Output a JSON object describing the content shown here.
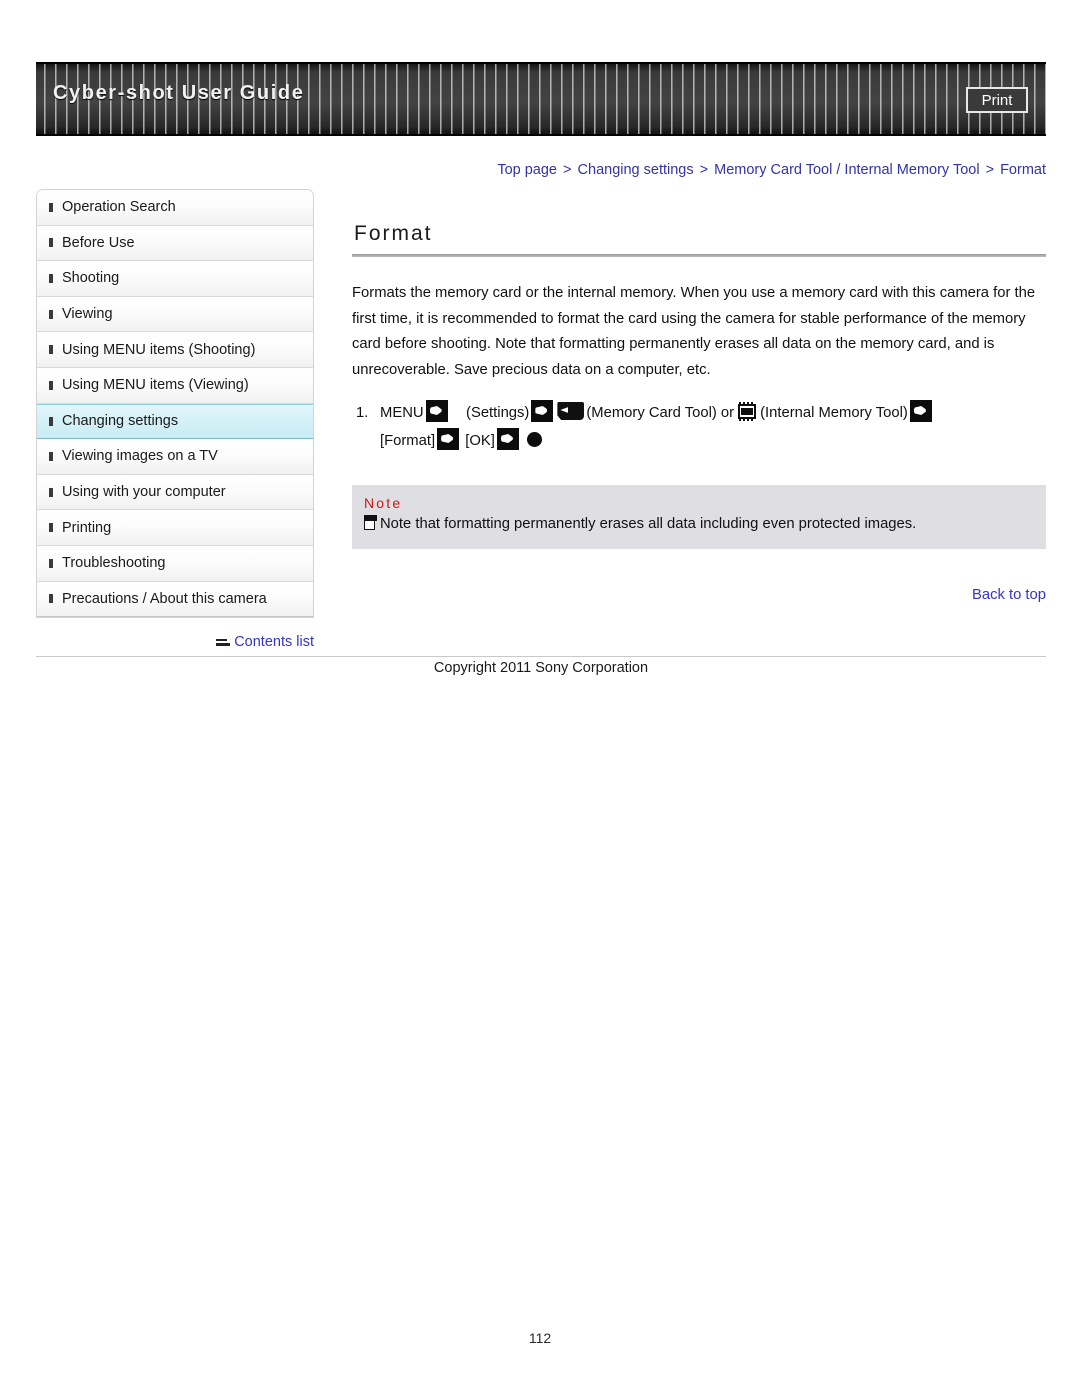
{
  "header": {
    "title": "Cyber-shot User Guide",
    "print_label": "Print"
  },
  "breadcrumb": {
    "items": [
      "Top page",
      "Changing settings",
      "Memory Card Tool / Internal Memory Tool",
      "Format"
    ],
    "separator": ">",
    "color": "#3333aa"
  },
  "sidebar": {
    "items": [
      {
        "label": "Operation Search",
        "active": false
      },
      {
        "label": "Before Use",
        "active": false
      },
      {
        "label": "Shooting",
        "active": false
      },
      {
        "label": "Viewing",
        "active": false
      },
      {
        "label": "Using MENU items (Shooting)",
        "active": false
      },
      {
        "label": "Using MENU items (Viewing)",
        "active": false
      },
      {
        "label": "Changing settings",
        "active": true
      },
      {
        "label": "Viewing images on a TV",
        "active": false
      },
      {
        "label": "Using with your computer",
        "active": false
      },
      {
        "label": "Printing",
        "active": false
      },
      {
        "label": "Troubleshooting",
        "active": false
      },
      {
        "label": "Precautions / About this camera",
        "active": false
      }
    ],
    "contents_list_label": "Contents list",
    "contents_list_icon": "contents-list-icon",
    "active_bg": "#d4f0f7"
  },
  "main": {
    "title": "Format",
    "paragraph": "Formats the memory card or the internal memory. When you use a memory card with this camera for the first time, it is recommended to format the card using the camera for stable performance of the memory card before shooting. Note that formatting permanently erases all data on the memory card, and is unrecoverable. Save precious data on a computer, etc.",
    "step": {
      "number": "1.",
      "t1": "MENU",
      "t2": "(Settings)",
      "t3": "(Memory Card Tool) or",
      "t4": "(Internal Memory Tool)",
      "t5": "[Format]",
      "t6": "[OK]",
      "icons": [
        "control-button-icon",
        "control-button-icon",
        "memory-card-icon",
        "internal-memory-chip-icon",
        "control-button-icon",
        "control-button-icon",
        "control-button-icon",
        "center-button-icon"
      ]
    },
    "note": {
      "title": "Note",
      "title_color": "#d31414",
      "text": "Note that formatting permanently erases all data including even protected images.",
      "bg": "#dfdfe3"
    },
    "back_to_top": "Back to top"
  },
  "footer": {
    "copyright": "Copyright 2011 Sony Corporation",
    "page_number": "112"
  }
}
